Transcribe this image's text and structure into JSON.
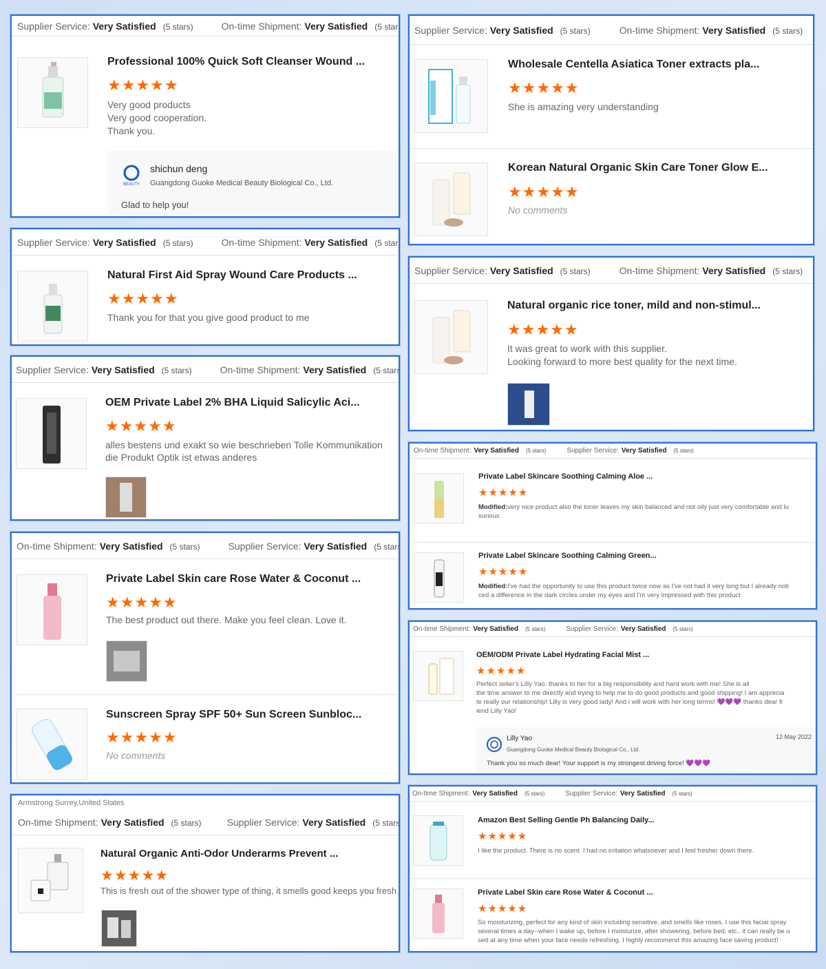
{
  "labels": {
    "supplier": "Supplier Service:",
    "shipment": "On-time Shipment:",
    "very_satisfied": "Very Satisfied",
    "five_stars": "(5 stars)",
    "stars": "★★★★★",
    "no_comments": "No comments",
    "modified": "Modified:"
  },
  "cards": {
    "c1": {
      "item1": {
        "title": "Professional 100% Quick Soft Cleanser Wound ...",
        "text": [
          "Very good products",
          "Very good cooperation.",
          "Thank you."
        ]
      },
      "reply": {
        "name": "shichun deng",
        "company": "Guangdong Guoke Medical Beauty Biological Co., Ltd.",
        "message": "Glad to help you!",
        "logo_text": "BEAUTY"
      }
    },
    "c2": {
      "item1": {
        "title": "Natural First Aid Spray Wound Care Products ...",
        "text": [
          "Thank you for that you give good product to me"
        ]
      }
    },
    "c3": {
      "item1": {
        "title": "OEM Private Label 2% BHA Liquid Salicylic Aci...",
        "text": [
          "alles bestens und exakt so wie beschrieben Tolle Kommunikation",
          "die Produkt Optik ist etwas anderes"
        ]
      }
    },
    "c4": {
      "item1": {
        "title": "Private Label Skin care Rose Water & Coconut ...",
        "text": [
          "The best product out there. Make you feel clean. Love it."
        ]
      },
      "item2": {
        "title": "Sunscreen Spray SPF 50+ Sun Screen Sunbloc..."
      }
    },
    "c5": {
      "location": "Armstrong Surrey,United States",
      "item1": {
        "title": "Natural Organic Anti-Odor Underarms Prevent ...",
        "text": [
          "This is fresh out of the shower type of thing, it smells good keeps you fresh"
        ]
      }
    },
    "c6": {
      "item1": {
        "title": "Wholesale Centella Asiatica Toner extracts pla...",
        "text": [
          "She is amazing very understanding"
        ]
      },
      "item2": {
        "title": "Korean Natural Organic Skin Care Toner Glow E..."
      }
    },
    "c7": {
      "item1": {
        "title": "Natural organic rice toner, mild and non-stimul...",
        "text": [
          "It was great to work with this supplier.",
          "Looking forward to more best quality for the next time."
        ]
      }
    },
    "c8": {
      "item1": {
        "title": "Private Label Skincare Soothing Calming Aloe ...",
        "text": [
          "very nice product also the toner leaves my skin balanced and not oily just very comfortable and lu",
          "xurious"
        ]
      },
      "item2": {
        "title": "Private Label Skincare Soothing Calming Green...",
        "text": [
          "I've had the opportunity to use this product twice now as I've not had it very long but I already noti",
          "ced a difference in the dark circles under my eyes and I'm very impressed with this product"
        ]
      }
    },
    "c9": {
      "item1": {
        "title": "OEM/ODM Private Label Hydrating Facial Mist ...",
        "text": [
          "Perfect seller's Lilly Yao. thanks to her for a big responsibility and hard work with me! She is all",
          "the time answer to me directly and trying to help me to do good products and good shipping! I am apprecia",
          "te really our relationship! Lilly is very good lady! And i will work with her long terms!"
        ],
        "text_end": "thanks dear fr",
        "text_last": "iend Lilly Yao!",
        "hearts": "💜💜💜"
      },
      "reply": {
        "name": "Lilly Yao",
        "company": "Guangdong Guoke Medical Beauty Biological Co., Ltd.",
        "date": "12 May 2022",
        "message": "Thank you so much dear! Your support is my strongest driving force!",
        "hearts": "💜💜💜"
      }
    },
    "c10": {
      "item1": {
        "title": "Amazon Best Selling Gentle Ph Balancing Daily...",
        "text": [
          "I like the product. There is no scent. I had no irritation whatsoever and I feel fresher down there."
        ]
      },
      "item2": {
        "title": "Private Label Skin care Rose Water & Coconut ...",
        "text": [
          "So moisturizing, perfect for any kind of skin including sensitive, and smells like roses. I use this facial spray",
          "several times a day--when I wake up, before I moisturize, after showering, before bed, etc.. it can really be u",
          "sed at any time when your face needs refreshing.  I highly recommend this amazing face saving product!"
        ]
      }
    }
  },
  "colors": {
    "accent": "#2f6fd0",
    "stars": "#ff6a00"
  }
}
